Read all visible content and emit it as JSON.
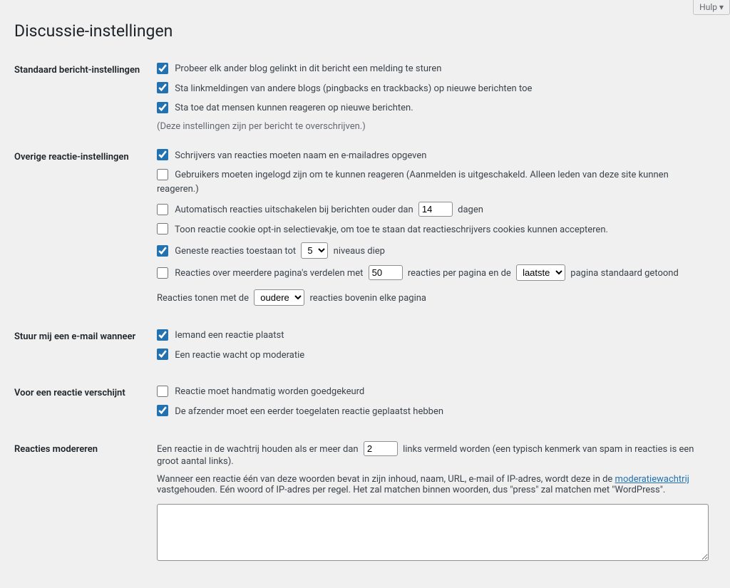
{
  "help_button": "Hulp ▾",
  "page_title": "Discussie-instellingen",
  "sections": {
    "default": {
      "heading": "Standaard bericht-instellingen",
      "opt1": "Probeer elk ander blog gelinkt in dit bericht een melding te sturen",
      "opt2": "Sta linkmeldingen van andere blogs (pingbacks en trackbacks) op nieuwe berichten toe",
      "opt3": "Sta toe dat mensen kunnen reageren op nieuwe berichten.",
      "note": "(Deze instellingen zijn per bericht te overschrijven.)"
    },
    "other": {
      "heading": "Overige reactie-instellingen",
      "opt1": "Schrijvers van reacties moeten naam en e-mailadres opgeven",
      "opt2": "Gebruikers moeten ingelogd zijn om te kunnen reageren (Aanmelden is uitgeschakeld. Alleen leden van deze site kunnen reageren.)",
      "opt3_pre": "Automatisch reacties uitschakelen bij berichten ouder dan",
      "opt3_days_value": "14",
      "opt3_post": "dagen",
      "opt4": "Toon reactie cookie opt-in selectievakje, om toe te staan dat reactieschrijvers cookies kunnen accepteren.",
      "opt5_pre": "Geneste reacties toestaan tot",
      "opt5_level_value": "5",
      "opt5_post": "niveaus diep",
      "opt6_pre": "Reacties over meerdere pagina's verdelen met",
      "opt6_perpage_value": "50",
      "opt6_mid": "reacties per pagina en de",
      "opt6_select_value": "laatste",
      "opt6_post": "pagina standaard getoond",
      "opt7_pre": "Reacties tonen met de",
      "opt7_select_value": "oudere",
      "opt7_post": "reacties bovenin elke pagina"
    },
    "email": {
      "heading": "Stuur mij een e-mail wanneer",
      "opt1": "Iemand een reactie plaatst",
      "opt2": "Een reactie wacht op moderatie"
    },
    "before": {
      "heading": "Voor een reactie verschijnt",
      "opt1": "Reactie moet handmatig worden goedgekeurd",
      "opt2": "De afzender moet een eerder toegelaten reactie geplaatst hebben"
    },
    "moderate": {
      "heading": "Reacties modereren",
      "p1_pre": "Een reactie in de wachtrij houden als er meer dan",
      "links_value": "2",
      "p1_post": "links vermeld worden (een typisch kenmerk van spam in reacties is een groot aantal links).",
      "p2_pre": "Wanneer een reactie één van deze woorden bevat in zijn inhoud, naam, URL, e-mail of IP-adres, wordt deze in de ",
      "p2_link": "moderatiewachtrij",
      "p2_post": " vastgehouden. Eén woord of IP-adres per regel. Het zal matchen binnen woorden, dus \"press\" zal matchen met \"WordPress\"."
    }
  }
}
